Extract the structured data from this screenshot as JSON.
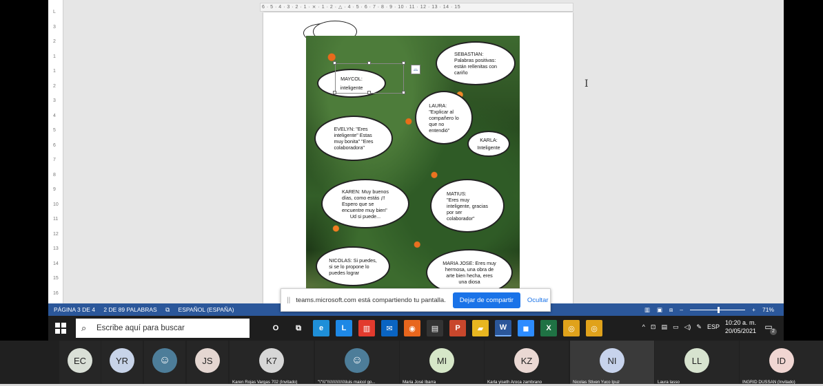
{
  "word": {
    "hruler_text": "6 · 5 · 4 · 3 · 2 · 1 · ⨯ · 1 · 2 · △ · 4 · 5 · 6 · 7 · 8 · 9 · 10 · 11 · 12 · 13 · 14 · 15",
    "vruler_marks": [
      "L",
      "3",
      "2",
      "1",
      "1",
      "2",
      "3",
      "4",
      "5",
      "6",
      "7",
      "8",
      "9",
      "10",
      "11",
      "12",
      "13",
      "14",
      "15",
      "16"
    ],
    "cursor": "I"
  },
  "bubbles": {
    "maycol": [
      "MAYCOL:",
      "inteligente"
    ],
    "sebastian": [
      "SEBASTIAN:",
      "Palabras positivas:",
      "están rellenitas con",
      "cariño"
    ],
    "laura": [
      "LAURA:",
      "\"Explicar al",
      "compañero lo",
      "que no",
      "entendió\""
    ],
    "evelyn": [
      "EVELYN: \"Eres",
      "inteligente\" Estas",
      "muy bonita\" \"Eres",
      "colaboradora\""
    ],
    "karla": [
      "KARLA:",
      "Inteligente"
    ],
    "karen": [
      "KAREN: Muy buenos",
      "días, como estás ¡!!",
      "Espero que se",
      "encuentre muy bien\"",
      "Ud si puede..."
    ],
    "matius": [
      "MATIUS:",
      "\"Eres muy",
      "inteligente, gracias",
      "por ser",
      "colaborador\""
    ],
    "nicolas": [
      "NICOLAS: Si puedes,",
      "si se lo propone lo",
      "puedes lograr"
    ],
    "mariajose": [
      "MARIA JOSE: Eres muy",
      "hermosa, una obra de",
      "arte bien hecha, eres",
      "una diosa"
    ]
  },
  "status": {
    "page": "PÁGINA 3 DE 4",
    "words": "2 DE 89 PALABRAS",
    "lang": "ESPAÑOL (ESPAÑA)",
    "zoom": "71%"
  },
  "share": {
    "message": "teams.microsoft.com está compartiendo tu pantalla.",
    "stop": "Dejar de compartir",
    "hide": "Ocultar"
  },
  "taskbar": {
    "search_placeholder": "Escribe aquí para buscar",
    "lang": "ESP",
    "time": "10:20 a. m.",
    "date": "20/05/2021",
    "notif_count": "2",
    "apps": [
      {
        "name": "cortana-icon",
        "label": "O",
        "color": "transparent"
      },
      {
        "name": "task-view-icon",
        "label": "⧉",
        "color": "transparent"
      },
      {
        "name": "edge-icon",
        "label": "e",
        "color": "#1f8fd8"
      },
      {
        "name": "l-app-icon",
        "label": "L",
        "color": "#1e88e5"
      },
      {
        "name": "office-icon",
        "label": "▥",
        "color": "#e23b2e"
      },
      {
        "name": "mail-icon",
        "label": "✉",
        "color": "#0a64c2"
      },
      {
        "name": "firefox-icon",
        "label": "◉",
        "color": "#e8661d"
      },
      {
        "name": "store-icon",
        "label": "▤",
        "color": "#333"
      },
      {
        "name": "powerpoint-icon",
        "label": "P",
        "color": "#c8472c"
      },
      {
        "name": "explorer-icon",
        "label": "▰",
        "color": "#e8b620"
      },
      {
        "name": "word-icon",
        "label": "W",
        "color": "#2b579a"
      },
      {
        "name": "zoom-icon",
        "label": "◼",
        "color": "#2d8cff"
      },
      {
        "name": "excel-icon",
        "label": "X",
        "color": "#1f7244"
      },
      {
        "name": "chrome-icon",
        "label": "◎",
        "color": "#e0a21b"
      },
      {
        "name": "chrome-icon-2",
        "label": "◎",
        "color": "#e0a21b"
      }
    ]
  },
  "participants": [
    {
      "initials": "EC",
      "name": "",
      "bg": "#d9dfd6"
    },
    {
      "initials": "YR",
      "name": "",
      "bg": "#c7d3e8"
    },
    {
      "initials": "",
      "name": "",
      "bg": "#4d7d99"
    },
    {
      "initials": "JS",
      "name": "",
      "bg": "#e4d6d1"
    },
    {
      "initials": "K7",
      "name": "Karen Rojas Vargas 702 (Invitado)",
      "bg": "#d7d7d7"
    },
    {
      "initials": "",
      "name": "\"\\\"\\\\\\\"\\\\\\\\\\\\\\\\\\\\\\\\\\\\\\\\luis  maicol go...",
      "bg": "#4d7d99"
    },
    {
      "initials": "MI",
      "name": "Maria José Ibarra",
      "bg": "#d6e7c8"
    },
    {
      "initials": "KZ",
      "name": "Karla yiseth Aroca zambrano",
      "bg": "#ead8d3"
    },
    {
      "initials": "NI",
      "name": "Nicolas Stiven Yuco Ipuz",
      "bg": "#c7d3ec"
    },
    {
      "initials": "LL",
      "name": "Laura lasso",
      "bg": "#d7e3cf"
    },
    {
      "initials": "ID",
      "name": "INGRID DUSSAN (Invitado)",
      "bg": "#f0d6d2"
    }
  ],
  "colors": {
    "word_blue": "#2b579a",
    "share_blue": "#1a73e8"
  }
}
